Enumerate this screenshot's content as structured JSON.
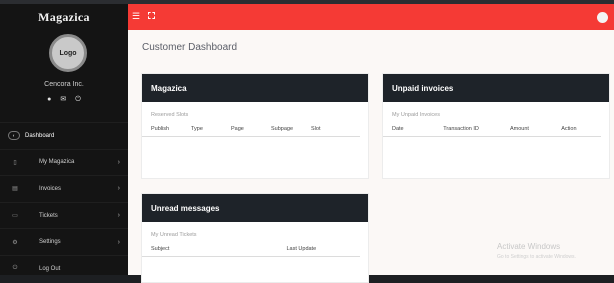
{
  "sidebar": {
    "brand": "Magazica",
    "logo_text": "Logo",
    "company": "Cencora Inc.",
    "user_icons": [
      "status-icon",
      "mail-icon",
      "power-icon"
    ],
    "items": [
      {
        "label": "Dashboard",
        "icon": "dashboard-icon",
        "active": true,
        "has_caret": false
      },
      {
        "label": "My Magazica",
        "icon": "book-icon",
        "active": false,
        "has_caret": true
      },
      {
        "label": "Invoices",
        "icon": "invoice-icon",
        "active": false,
        "has_caret": true
      },
      {
        "label": "Tickets",
        "icon": "ticket-icon",
        "active": false,
        "has_caret": true
      },
      {
        "label": "Settings",
        "icon": "gear-icon",
        "active": false,
        "has_caret": true
      },
      {
        "label": "Log Out",
        "icon": "power-icon",
        "active": false,
        "has_caret": false
      }
    ]
  },
  "topbar": {
    "color": "#f53a35",
    "icons": [
      "hamburger-icon",
      "fullscreen-icon",
      "user-avatar"
    ]
  },
  "main": {
    "title": "Customer Dashboard",
    "cards": {
      "magazica": {
        "title": "Magazica",
        "subtitle": "Reserved Slots",
        "columns": [
          "Publish",
          "Type",
          "Page",
          "Subpage",
          "Slot"
        ]
      },
      "invoices": {
        "title": "Unpaid invoices",
        "subtitle": "My Unpaid Invoices",
        "columns": [
          "Date",
          "Transaction ID",
          "Amount",
          "Action"
        ]
      },
      "messages": {
        "title": "Unread messages",
        "subtitle": "My Unread Tickets",
        "columns": [
          "Subject",
          "Last Update"
        ]
      }
    }
  },
  "watermark": {
    "line1": "Activate Windows",
    "line2": "Go to Settings to activate Windows."
  }
}
